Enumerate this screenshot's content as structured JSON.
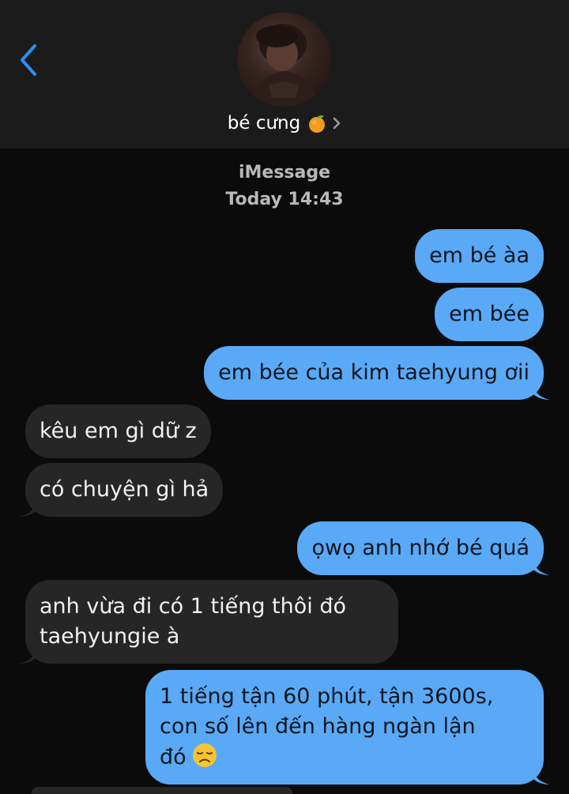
{
  "header": {
    "contact_name": "bé cưng",
    "name_emoji": "tangerine-icon",
    "back_icon": "chevron-left-icon",
    "detail_icon": "chevron-right-icon"
  },
  "meta": {
    "service": "iMessage",
    "timestamp": "Today 14:43"
  },
  "messages": [
    {
      "direction": "sent",
      "text": "em bé àa"
    },
    {
      "direction": "sent",
      "text": "em bée"
    },
    {
      "direction": "sent",
      "text": "em bée của kim taehyung ơii"
    },
    {
      "direction": "received",
      "text": "kêu em gì dữ z"
    },
    {
      "direction": "received",
      "text": "có chuyện gì hả"
    },
    {
      "direction": "sent",
      "text": "ọwọ anh nhớ bé quá"
    },
    {
      "direction": "received",
      "lines": [
        "anh vừa đi có 1 tiếng thôi đó",
        "taehyungie à"
      ]
    },
    {
      "direction": "sent",
      "lines": [
        "1 tiếng tận 60 phút, tận 3600s,",
        "con số lên đến hàng ngàn lận",
        "đó"
      ],
      "trailing_emoji": "disappointed-face-icon"
    }
  ],
  "colors": {
    "sent_bubble": "#5aa9f6",
    "received_bubble": "#262626",
    "header_bg": "#1b1b1b",
    "background": "#0b0b0b",
    "accent": "#2f8ef0"
  }
}
